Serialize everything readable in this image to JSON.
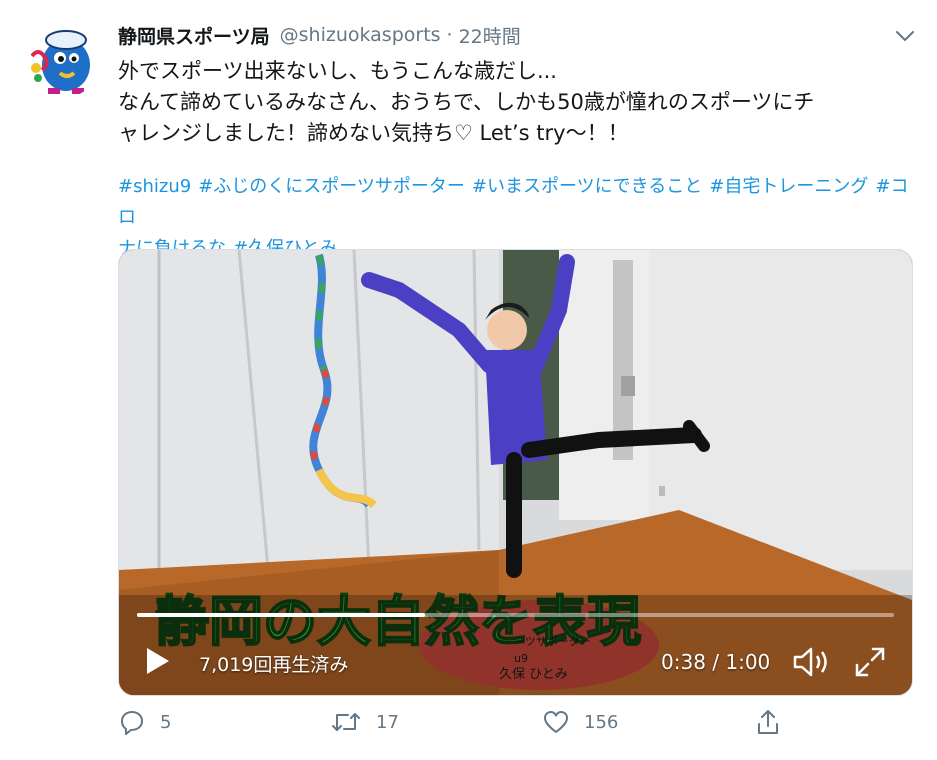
{
  "tweet": {
    "display_name": "静岡県スポーツ局",
    "handle": "@shizuokasports",
    "separator": "·",
    "time": "22時間",
    "text_lines": [
      "外でスポーツ出来ないし、もうこんな歳だし...",
      "なんて諦めているみなさん、おうちで、しかも50歳が憧れのスポーツにチ",
      "ャレンジしました！諦めない気持ち♡ Let’s try～！！"
    ],
    "hashtags": [
      "#shizu9",
      "#ふじのくにスポーツサポーター",
      "#いまスポーツにできること",
      "#自宅トレーニング",
      "#コロ",
      "ナに負けるな",
      "#久保ひとみ"
    ]
  },
  "video": {
    "caption_overlay": "静岡の大自然を表現",
    "lower_third": [
      "ーツサポーター",
      "u9",
      "久保 ひとみ"
    ],
    "views": "7,019回再生済み",
    "duration": "0:38 / 1:00",
    "progress": 0.38
  },
  "actions": {
    "reply_count": "5",
    "retweet_count": "17",
    "like_count": "156"
  },
  "icons": [
    "avatar-mascot",
    "chevron-down-icon",
    "play-icon",
    "volume-icon",
    "fullscreen-icon",
    "reply-icon",
    "retweet-icon",
    "like-icon",
    "share-icon"
  ],
  "colors": {
    "link": "#1b95e0",
    "muted": "#657786",
    "leotard": "#4b3fc4",
    "caption_green": "#3dd645"
  }
}
